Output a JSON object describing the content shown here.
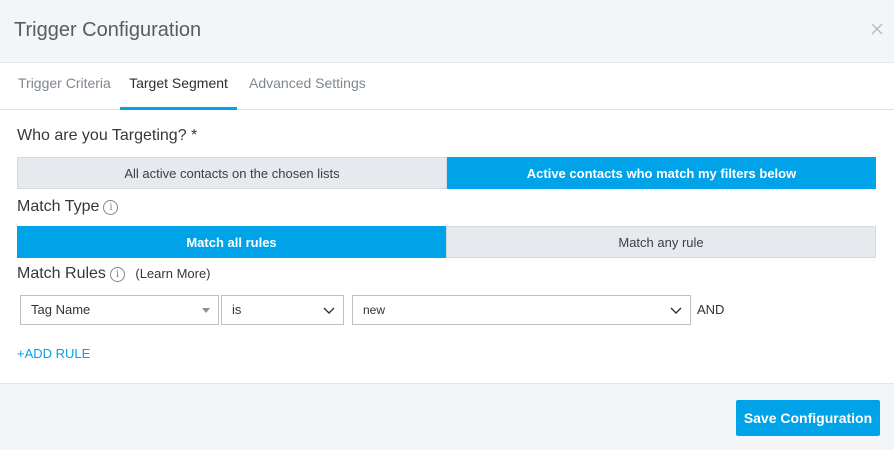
{
  "modal": {
    "title": "Trigger Configuration"
  },
  "tabs": [
    {
      "label": "Trigger Criteria",
      "active": false
    },
    {
      "label": "Target Segment",
      "active": true
    },
    {
      "label": "Advanced Settings",
      "active": false
    }
  ],
  "targeting": {
    "label": "Who are you Targeting? *",
    "options": [
      {
        "label": "All active contacts on the chosen lists",
        "selected": false
      },
      {
        "label": "Active contacts who match my filters below",
        "selected": true
      }
    ]
  },
  "match_type": {
    "label": "Match Type",
    "options": [
      {
        "label": "Match all rules",
        "selected": true
      },
      {
        "label": "Match any rule",
        "selected": false
      }
    ]
  },
  "match_rules": {
    "label": "Match Rules",
    "learn_more": "(Learn More)",
    "rules": [
      {
        "field": "Tag Name",
        "operator": "is",
        "value": "new",
        "conjunction": "AND"
      }
    ],
    "add_rule": "+ADD RULE"
  },
  "footer": {
    "save_label": "Save Configuration"
  },
  "colors": {
    "accent": "#00a2e8",
    "header_bg": "#f3f6f9",
    "segment_off": "#e6eaee"
  },
  "icons": {
    "close": "close-icon",
    "info": "info-icon",
    "dropdown": "chevron-down-icon"
  }
}
